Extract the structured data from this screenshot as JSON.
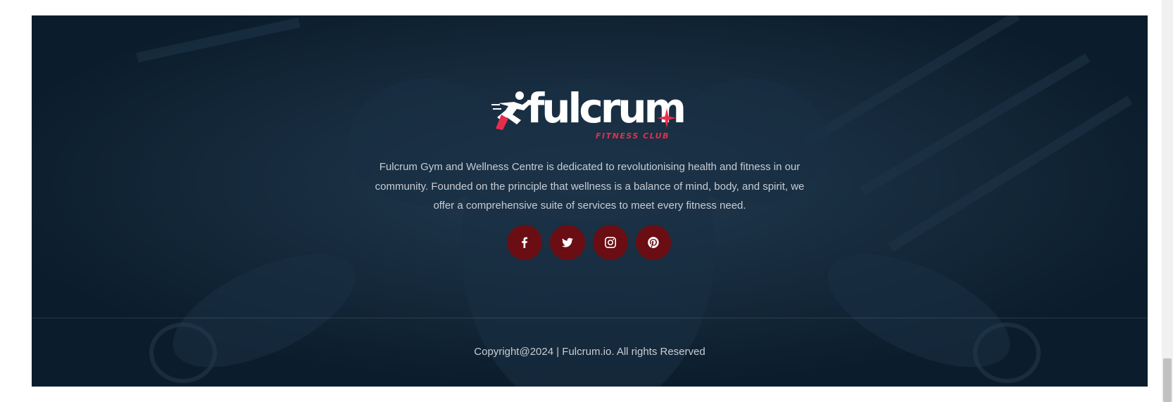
{
  "footer": {
    "logo": {
      "wordmark": "fulcrum",
      "tagline": "FITNESS CLUB"
    },
    "about_text": "Fulcrum Gym and Wellness Centre is dedicated to revolutionising health and fitness in our community. Founded on the principle that wellness is a balance of mind, body, and spirit, we offer a comprehensive suite of services to meet every fitness need.",
    "social_links": [
      {
        "icon": "facebook-icon"
      },
      {
        "icon": "twitter-icon"
      },
      {
        "icon": "instagram-icon"
      },
      {
        "icon": "pinterest-icon"
      }
    ],
    "copyright": "Copyright@2024 | Fulcrum.io. All rights Reserved"
  },
  "colors": {
    "footer_bg": "#0d1f2f",
    "accent": "#e52e4d",
    "social_button": "#6a0e14",
    "text": "#c7cdd4"
  }
}
